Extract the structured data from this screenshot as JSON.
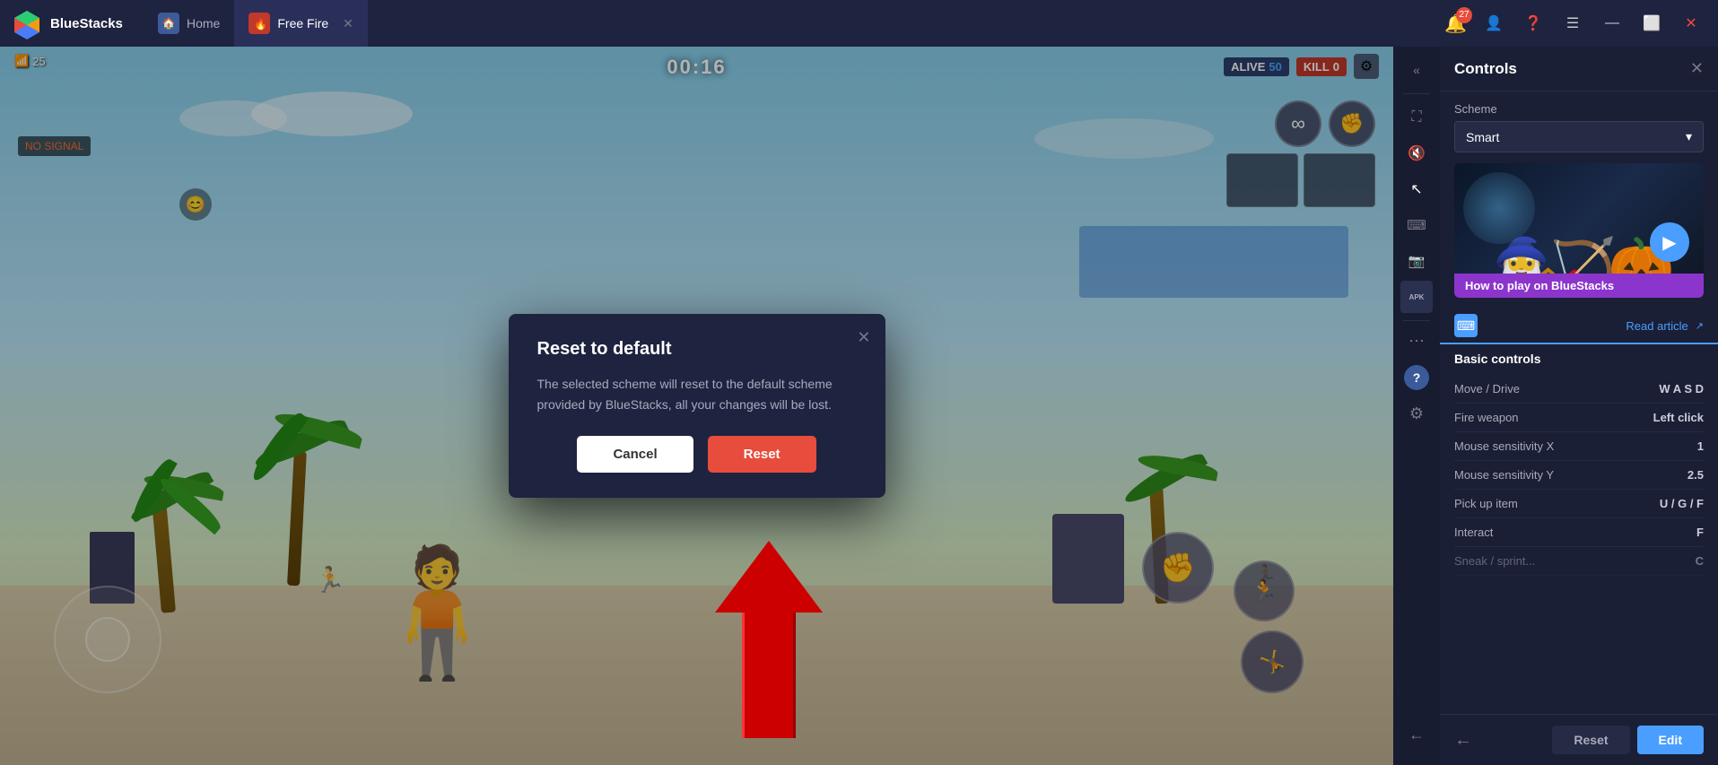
{
  "titleBar": {
    "logoText": "BlueStacks",
    "tabs": [
      {
        "id": "home",
        "label": "Home",
        "active": false
      },
      {
        "id": "freefire",
        "label": "Free Fire",
        "active": true
      }
    ],
    "notificationCount": "27",
    "buttons": [
      "minimize",
      "maximize",
      "close"
    ]
  },
  "hud": {
    "wifi": "25",
    "timer": "00:16",
    "alive": "50",
    "kill": "0",
    "noSignal": "NO SIGNAL"
  },
  "dialog": {
    "title": "Reset to default",
    "text": "The selected scheme will reset to the default scheme provided by BlueStacks, all your changes will be lost.",
    "cancelLabel": "Cancel",
    "resetLabel": "Reset"
  },
  "controls": {
    "panelTitle": "Controls",
    "schemeLabel": "Scheme",
    "schemeValue": "Smart",
    "videoCaption": "How to play on BlueStacks",
    "readArticle": "Read article",
    "basicControlsTitle": "Basic controls",
    "rows": [
      {
        "name": "Move / Drive",
        "key": "W A S D"
      },
      {
        "name": "Fire weapon",
        "key": "Left click"
      },
      {
        "name": "Mouse sensitivity X",
        "key": "1"
      },
      {
        "name": "Mouse sensitivity Y",
        "key": "2.5"
      },
      {
        "name": "Pick up item",
        "key": "U / G / F"
      },
      {
        "name": "Interact",
        "key": "F"
      }
    ],
    "footerButtons": {
      "reset": "Reset",
      "edit": "Edit"
    }
  }
}
